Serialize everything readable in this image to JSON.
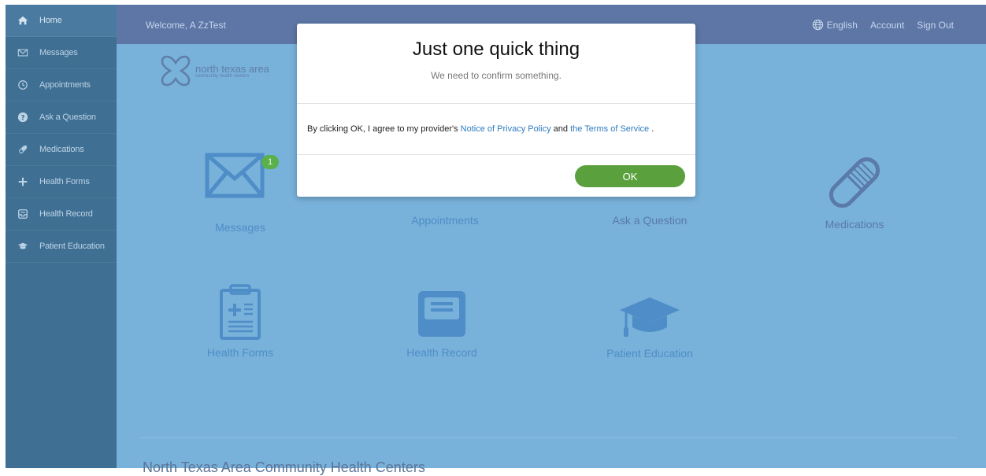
{
  "sidebar": {
    "items": [
      {
        "label": "Home",
        "icon": "home-icon"
      },
      {
        "label": "Messages",
        "icon": "envelope-icon"
      },
      {
        "label": "Appointments",
        "icon": "clock-icon"
      },
      {
        "label": "Ask a Question",
        "icon": "question-icon"
      },
      {
        "label": "Medications",
        "icon": "pill-icon"
      },
      {
        "label": "Health Forms",
        "icon": "plus-icon"
      },
      {
        "label": "Health Record",
        "icon": "inbox-icon"
      },
      {
        "label": "Patient Education",
        "icon": "graduation-cap-icon"
      }
    ]
  },
  "header": {
    "welcome": "Welcome, A ZzTest",
    "language": "English",
    "account": "Account",
    "signout": "Sign Out"
  },
  "logo": {
    "line1": "north texas area",
    "line2": "community health centers"
  },
  "tiles": {
    "messages": {
      "label": "Messages",
      "badge": "1"
    },
    "appointments": {
      "label": "Appointments"
    },
    "ask": {
      "label": "Ask a Question"
    },
    "medications": {
      "label": "Medications"
    },
    "health_forms": {
      "label": "Health Forms"
    },
    "health_record": {
      "label": "Health Record"
    },
    "patient_education": {
      "label": "Patient Education"
    }
  },
  "footer": {
    "title": "North Texas Area Community Health Centers"
  },
  "modal": {
    "title": "Just one quick thing",
    "subtitle": "We need to confirm something.",
    "body_prefix": "By clicking OK, I agree to my provider's ",
    "privacy_link": "Notice of Privacy Policy",
    "and": " and ",
    "terms_link": "the Terms of Service",
    "body_suffix": " .",
    "ok": "OK"
  },
  "colors": {
    "sidebar": "#3f6f93",
    "topbar": "#5d76a6",
    "main": "#78b1da",
    "ok_button": "#5aa13d",
    "link": "#2e7bbf",
    "badge": "#5ab04b"
  }
}
